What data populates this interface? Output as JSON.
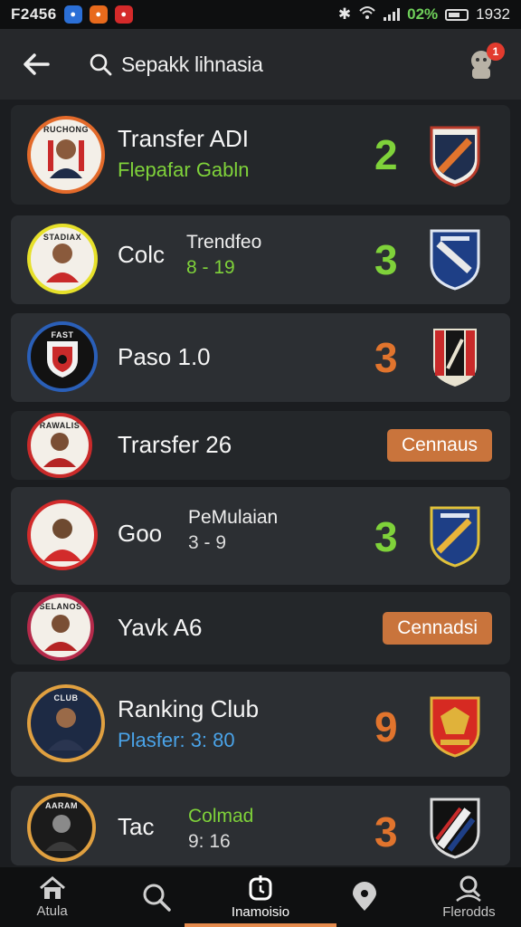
{
  "status_bar": {
    "time": "F2456",
    "battery": "02%",
    "clock": "1932"
  },
  "header": {
    "search_text": "Sepakk lihnasia",
    "notification_count": "1"
  },
  "colors": {
    "green": "#7fd23a",
    "orange": "#e1742d",
    "blue": "#4aa3e8",
    "accent": "#e48a4c"
  },
  "items": [
    {
      "name": "Transfer ADI",
      "subtitle": "Flepafar Gabln",
      "score": "2",
      "score_color": "green",
      "avatar_text": "RUCHONG",
      "badge": "shield-orange"
    },
    {
      "name": "Colc",
      "side_title": "Trendfeo",
      "side_score": "8 - 19",
      "score": "3",
      "score_color": "green",
      "avatar_text": "STADIAX",
      "badge": "shield-blue"
    },
    {
      "name": "Paso 1.0",
      "score": "3",
      "score_color": "orange",
      "avatar_text": "FAST",
      "badge": "shield-red"
    },
    {
      "name": "Trarsfer 26",
      "action_label": "Cennaus",
      "avatar_text": "RAWALIS"
    },
    {
      "name": "Goo",
      "side_title": "PeMulaian",
      "side_score": "3 - 9",
      "score": "3",
      "score_color": "green",
      "avatar_text": "",
      "badge": "shield-blue"
    },
    {
      "name": "Yavk A6",
      "action_label": "Cennadsi",
      "avatar_text": "SELANOS"
    },
    {
      "name": "Ranking Club",
      "subtitle": "Plasfer: 3: 80",
      "score": "9",
      "score_color": "orange",
      "avatar_text": "CLUB",
      "badge": "shield-red"
    },
    {
      "name": "Tac",
      "side_title": "Colmad",
      "side_score": "9: 16",
      "score": "3",
      "score_color": "orange",
      "avatar_text": "AARAM",
      "badge": "shield-dark"
    }
  ],
  "bottom_nav": [
    {
      "label": "Atula",
      "icon": "home-icon"
    },
    {
      "label": "",
      "icon": "search-icon"
    },
    {
      "label": "Inamoisio",
      "icon": "timer-icon"
    },
    {
      "label": "",
      "icon": "location-icon"
    },
    {
      "label": "Flerodds",
      "icon": "person-search-icon"
    }
  ]
}
